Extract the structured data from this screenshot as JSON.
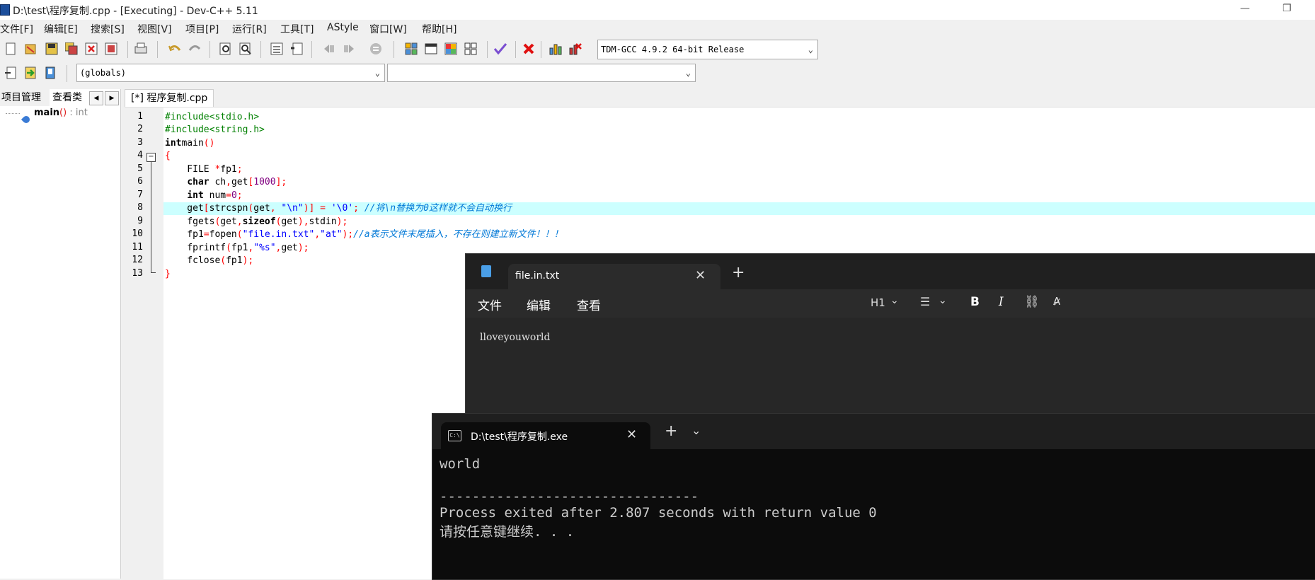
{
  "window": {
    "title": "D:\\test\\程序复制.cpp - [Executing] - Dev-C++ 5.11",
    "minimize_glyph": "—",
    "restore_glyph": "❐"
  },
  "menu": [
    "文件[F]",
    "编辑[E]",
    "搜索[S]",
    "视图[V]",
    "项目[P]",
    "运行[R]",
    "工具[T]",
    "AStyle",
    "窗口[W]",
    "帮助[H]"
  ],
  "toolbar": {
    "compiler_select": "TDM-GCC 4.9.2 64-bit Release",
    "scope_select": "(globals)",
    "member_select": ""
  },
  "left_panel": {
    "tabs": [
      "项目管理",
      "查看类"
    ],
    "tree_item_name": "main",
    "tree_item_parens": "()",
    "tree_item_type": ": int"
  },
  "editor": {
    "tab_label": "[*] 程序复制.cpp",
    "line_numbers": [
      "1",
      "2",
      "3",
      "4",
      "5",
      "6",
      "7",
      "8",
      "9",
      "10",
      "11",
      "12",
      "13"
    ]
  },
  "notepad": {
    "tab_title": "file.in.txt",
    "menu": [
      "文件",
      "编辑",
      "查看"
    ],
    "heading_button": "H1",
    "content": "lloveyouworld"
  },
  "terminal": {
    "tab_title": "D:\\test\\程序复制.exe",
    "lines": [
      "world",
      "",
      "--------------------------------",
      "Process exited after 2.807 seconds with return value 0",
      "请按任意键继续. . ."
    ]
  },
  "colors": {
    "highlight_line": "#ccffff",
    "notepad_bg": "#272727",
    "terminal_bg": "#0c0c0c"
  }
}
